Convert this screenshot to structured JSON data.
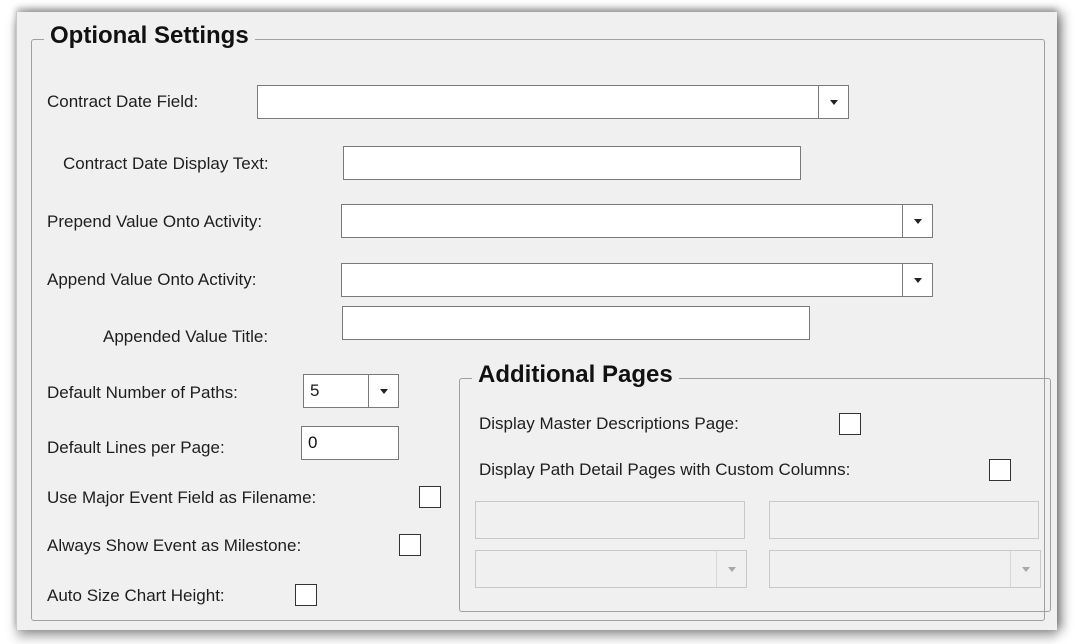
{
  "optional_settings": {
    "title": "Optional Settings",
    "contract_date_field": {
      "label": "Contract Date Field:",
      "value": ""
    },
    "contract_date_display_text": {
      "label": "Contract Date Display Text:",
      "value": ""
    },
    "prepend_value": {
      "label": "Prepend Value Onto Activity:",
      "value": ""
    },
    "append_value": {
      "label": "Append Value Onto Activity:",
      "value": ""
    },
    "appended_value_title": {
      "label": "Appended Value Title:",
      "value": ""
    },
    "default_number_of_paths": {
      "label": "Default Number of Paths:",
      "value": "5"
    },
    "default_lines_per_page": {
      "label": "Default Lines per Page:",
      "value": "0"
    },
    "use_major_event_filename": {
      "label": "Use Major Event Field as Filename:",
      "checked": false
    },
    "always_show_milestone": {
      "label": "Always Show Event as Milestone:",
      "checked": false
    },
    "auto_size_chart_height": {
      "label": "Auto Size Chart Height:",
      "checked": false
    }
  },
  "additional_pages": {
    "title": "Additional Pages",
    "display_master_descriptions": {
      "label": "Display Master Descriptions Page:",
      "checked": false
    },
    "display_path_detail_custom_columns": {
      "label": "Display Path Detail Pages with Custom Columns:",
      "checked": false
    },
    "custom_column_1_text": "",
    "custom_column_2_text": "",
    "custom_column_1_select": "",
    "custom_column_2_select": ""
  }
}
